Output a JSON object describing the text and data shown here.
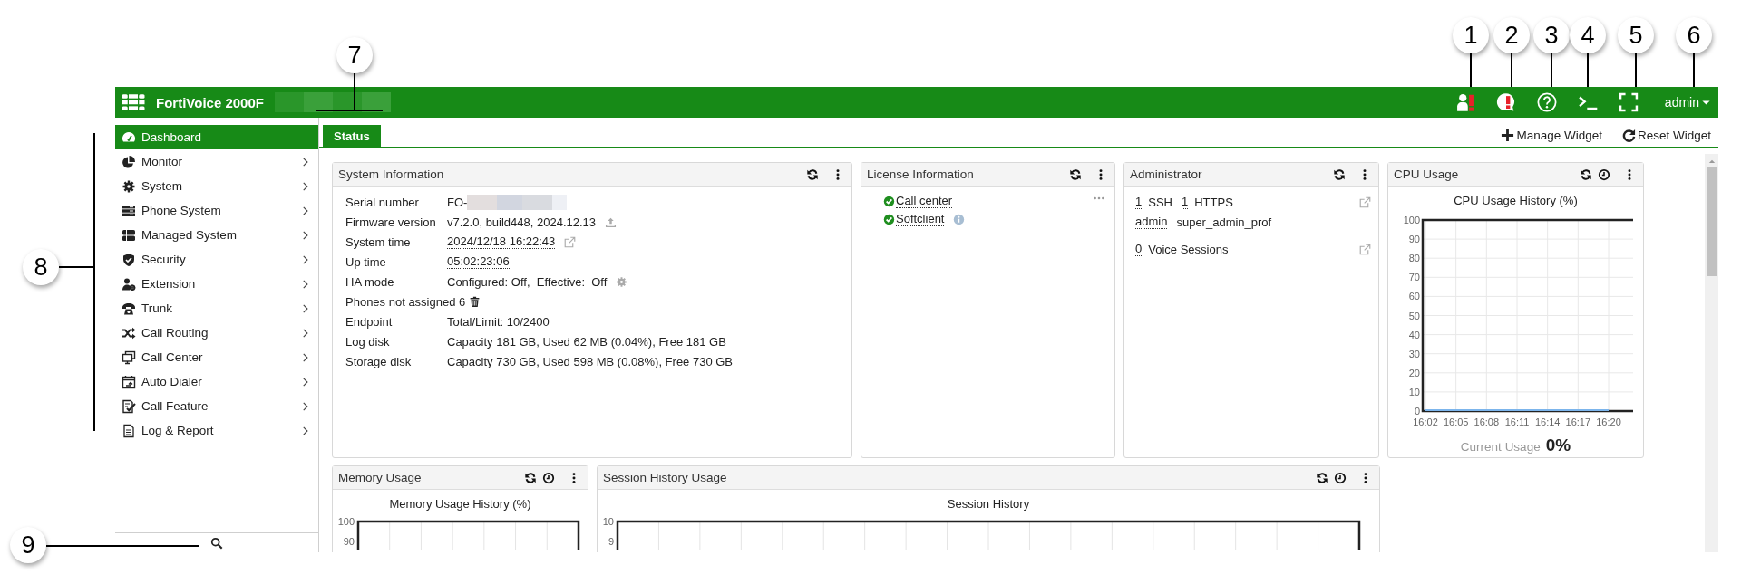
{
  "callouts": [
    {
      "number": "1"
    },
    {
      "number": "2"
    },
    {
      "number": "3"
    },
    {
      "number": "4"
    },
    {
      "number": "5"
    },
    {
      "number": "6"
    },
    {
      "number": "7"
    },
    {
      "number": "8"
    },
    {
      "number": "9"
    }
  ],
  "header": {
    "product": "FortiVoice 2000F",
    "user": "admin"
  },
  "sidebar": {
    "items": [
      {
        "label": "Dashboard",
        "selected": true,
        "expandable": false
      },
      {
        "label": "Monitor",
        "selected": false,
        "expandable": true
      },
      {
        "label": "System",
        "selected": false,
        "expandable": true
      },
      {
        "label": "Phone System",
        "selected": false,
        "expandable": true
      },
      {
        "label": "Managed System",
        "selected": false,
        "expandable": true
      },
      {
        "label": "Security",
        "selected": false,
        "expandable": true
      },
      {
        "label": "Extension",
        "selected": false,
        "expandable": true
      },
      {
        "label": "Trunk",
        "selected": false,
        "expandable": true
      },
      {
        "label": "Call Routing",
        "selected": false,
        "expandable": true
      },
      {
        "label": "Call Center",
        "selected": false,
        "expandable": true
      },
      {
        "label": "Auto Dialer",
        "selected": false,
        "expandable": true
      },
      {
        "label": "Call Feature",
        "selected": false,
        "expandable": true
      },
      {
        "label": "Log & Report",
        "selected": false,
        "expandable": true
      }
    ]
  },
  "tabs": [
    {
      "label": "Status",
      "selected": true
    }
  ],
  "actions": [
    {
      "label": "Manage Widget"
    },
    {
      "label": "Reset Widget"
    }
  ],
  "widgets": [
    {
      "kind": "system_info",
      "title": "System Information",
      "rows": [
        {
          "kind": "redacted",
          "label": "Serial number",
          "value": "FO-"
        },
        {
          "kind": "value",
          "label": "Firmware version",
          "value": "v7.2.0, build448, 2024.12.13"
        },
        {
          "kind": "link",
          "label": "System time",
          "value": "2024/12/18 16:22:43"
        },
        {
          "kind": "link",
          "label": "Up time",
          "value": "05:02:23:06"
        },
        {
          "kind": "value",
          "label": "HA mode",
          "value": "Configured: Off,  Effective:  Off"
        },
        {
          "kind": "label",
          "label": "Phones not assigned 6"
        },
        {
          "kind": "value",
          "label": "Endpoint",
          "value": "Total/Limit: 10/2400"
        },
        {
          "kind": "value",
          "label": "Log disk",
          "value": "Capacity 181 GB, Used 62 MB (0.04%), Free 181 GB"
        },
        {
          "kind": "value",
          "label": "Storage disk",
          "value": "Capacity 730 GB, Used 598 MB (0.08%), Free 730 GB"
        }
      ]
    },
    {
      "kind": "license",
      "title": "License Information",
      "items": [
        {
          "label": "Call center",
          "valid": true
        },
        {
          "label": "Softclient",
          "valid": true
        }
      ]
    },
    {
      "kind": "admin",
      "title": "Administrator",
      "sessions": [
        {
          "count": "1",
          "label": "SSH"
        },
        {
          "count": "1",
          "label": "HTTPS"
        }
      ],
      "user": {
        "name": "admin",
        "profile": "super_admin_prof"
      },
      "voice": {
        "count": "0",
        "label": "Voice Sessions"
      }
    },
    {
      "kind": "cpu",
      "title": "CPU Usage",
      "current_label": "Current Usage",
      "current_value": "0%",
      "chart_data": {
        "type": "line",
        "title": "CPU Usage History (%)",
        "x": [
          "16:02",
          "16:05",
          "16:08",
          "16:11",
          "16:14",
          "16:17",
          "16:20"
        ],
        "ylim": [
          0,
          100
        ],
        "yticks": [
          0,
          10,
          20,
          30,
          40,
          50,
          60,
          70,
          80,
          90,
          100
        ],
        "grid": true,
        "series": [
          {
            "color": "#7cb5ec",
            "values": [
              0,
              0,
              0,
              0,
              0,
              0,
              0
            ]
          }
        ]
      }
    },
    {
      "kind": "partial_chart",
      "title": "Memory Usage",
      "history_chart": {
        "title": "Memory Usage History (%)",
        "y_labels": [
          "100",
          "90"
        ]
      }
    },
    {
      "kind": "partial_chart",
      "title": "Session History Usage",
      "history_chart": {
        "title": "Session History",
        "y_labels": [
          "10",
          "9"
        ]
      }
    }
  ]
}
